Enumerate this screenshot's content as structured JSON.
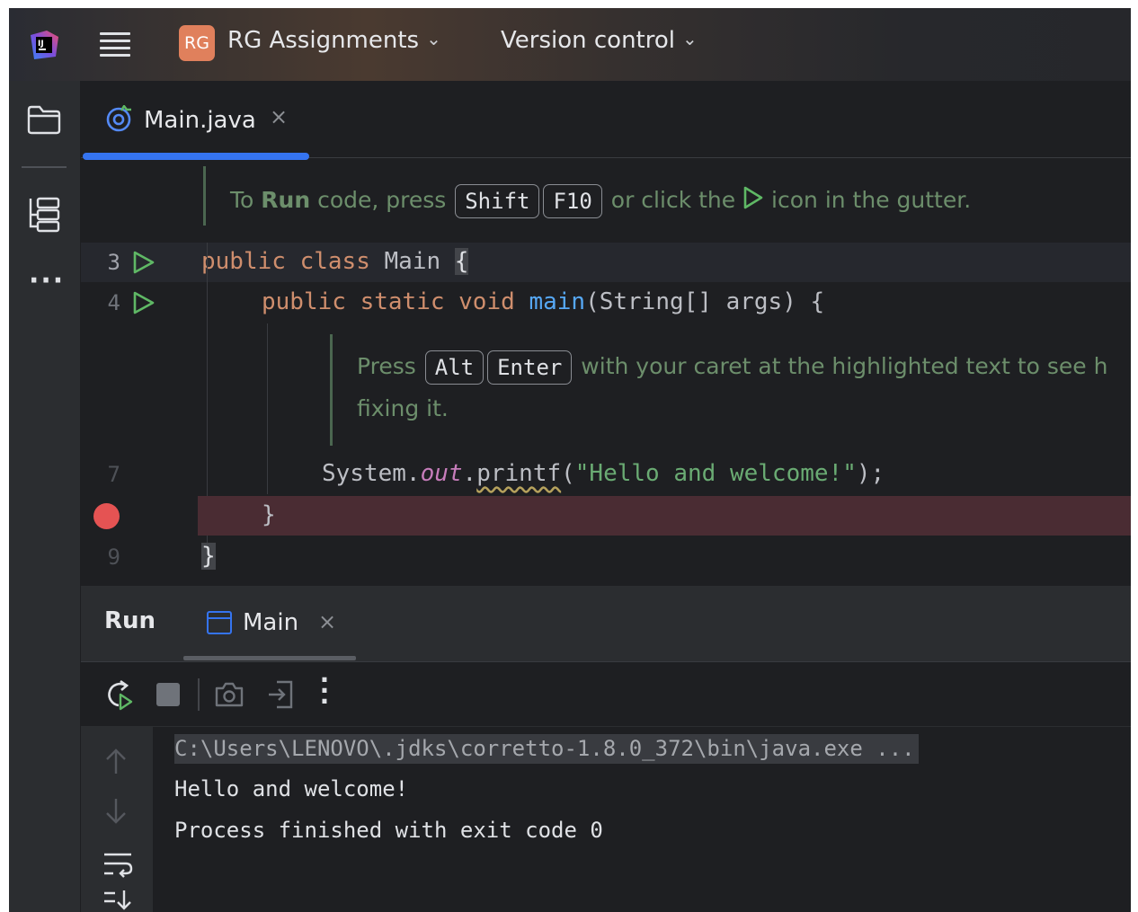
{
  "title_bar": {
    "project_badge": "RG",
    "project_name": "RG Assignments",
    "vcs_label": "Version control",
    "chevron": "⌄",
    "icons": [
      "intellij-logo-icon",
      "main-menu-icon"
    ]
  },
  "tool_strip": {
    "icons": [
      "project-folder-icon",
      "structure-icon",
      "more-tools-icon"
    ]
  },
  "editor": {
    "tab": {
      "label": "Main.java",
      "close": "×",
      "icon": "java-class-icon"
    },
    "run_hint": {
      "prefix": "To ",
      "bold": "Run",
      "mid": " code, press ",
      "key1": "Shift",
      "key2": "F10",
      "after_keys": " or click the ",
      "suffix": " icon in the gutter."
    },
    "lines": [
      {
        "num": "3",
        "has_run": true
      },
      {
        "num": "4",
        "has_run": true
      },
      {
        "num": "7",
        "has_run": false
      },
      {
        "num": "",
        "breakpoint": true
      },
      {
        "num": "9",
        "has_run": false
      }
    ],
    "code": {
      "l3_kw1": "public",
      "l3_kw2": "class",
      "l3_name": "Main",
      "l3_brace": "{",
      "l4_kw1": "public",
      "l4_kw2": "static",
      "l4_kw3": "void",
      "l4_fn": "main",
      "l4_rest": "(String[] args) {",
      "l7_pre": "System.",
      "l7_field": "out",
      "l7_dot": ".",
      "l7_meth": "printf",
      "l7_open": "(",
      "l7_str": "\"Hello and welcome!\"",
      "l7_close": ");",
      "l8": "}",
      "l9": "}"
    },
    "fix_hint": {
      "prefix": "Press ",
      "key1": "Alt",
      "key2": "Enter",
      "suffix": " with your caret at the highlighted text to see h",
      "line2": "fixing it."
    },
    "colors": {
      "keyword": "#cf8e6d",
      "function": "#56a8f5",
      "string": "#6aab73",
      "breakpoint_line": "#4a2c33",
      "breakpoint": "#e55353",
      "run_icon": "#5fb865"
    }
  },
  "run_panel": {
    "title": "Run",
    "tab_label": "Main",
    "tab_close": "×",
    "toolbar_icons": [
      "rerun-icon",
      "stop-icon",
      "screenshot-icon",
      "exit-icon",
      "more-options-icon"
    ],
    "side_icons": [
      "scroll-up-icon",
      "scroll-down-icon",
      "soft-wrap-icon",
      "scroll-to-end-icon"
    ],
    "output": [
      "C:\\Users\\LENOVO\\.jdks\\corretto-1.8.0_372\\bin\\java.exe ...",
      "Hello and welcome!",
      "Process finished with exit code 0"
    ]
  }
}
